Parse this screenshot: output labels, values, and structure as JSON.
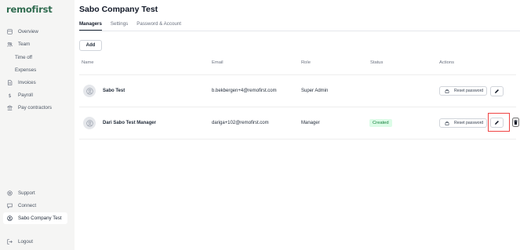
{
  "app": {
    "logo": "remofirst"
  },
  "sidebar": {
    "top_items": [
      {
        "label": "Overview",
        "icon": "overview-icon"
      },
      {
        "label": "Team",
        "icon": "team-icon"
      },
      {
        "label": "Time off",
        "icon": ""
      },
      {
        "label": "Expenses",
        "icon": ""
      },
      {
        "label": "Invoices",
        "icon": "invoice-icon"
      },
      {
        "label": "Payroll",
        "icon": "dollar-icon"
      },
      {
        "label": "Pay contractors",
        "icon": "bank-icon"
      }
    ],
    "bottom_items": [
      {
        "label": "Support",
        "icon": "support-icon"
      },
      {
        "label": "Connect",
        "icon": "chat-icon"
      },
      {
        "label": "Sabo Company Test",
        "icon": "user-circle-icon"
      },
      {
        "label": "Logout",
        "icon": "logout-icon"
      }
    ]
  },
  "page": {
    "title": "Sabo Company Test",
    "tabs": [
      {
        "label": "Managers",
        "active": true
      },
      {
        "label": "Settings",
        "active": false
      },
      {
        "label": "Password & Account",
        "active": false
      }
    ],
    "add_label": "Add"
  },
  "table": {
    "columns": [
      "Name",
      "Email",
      "Role",
      "Status",
      "Actions"
    ],
    "rows": [
      {
        "name": "Sabo Test",
        "email": "b.bekbergen+4@remofirst.com",
        "role": "Super Admin",
        "status": "",
        "reset_label": "Reset password"
      },
      {
        "name": "Dari Sabo Test Manager",
        "email": "dariga+102@remofirst.com",
        "role": "Manager",
        "status": "Created",
        "reset_label": "Reset password"
      }
    ]
  },
  "colors": {
    "brand": "#2f6b4f",
    "status_created_bg": "#dcfce7",
    "status_created_text": "#15803d",
    "highlight": "#ef4444"
  }
}
